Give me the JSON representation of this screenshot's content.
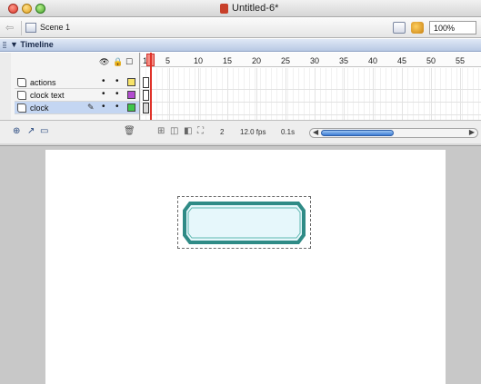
{
  "window": {
    "title": "Untitled-6*"
  },
  "edit_bar": {
    "scene_label": "Scene 1",
    "zoom_value": "100%"
  },
  "timeline": {
    "title": "Timeline",
    "frame_numbers": [
      "1",
      "5",
      "10",
      "15",
      "20",
      "25",
      "30",
      "35",
      "40",
      "45",
      "50",
      "55"
    ],
    "layers": [
      {
        "name": "actions",
        "color": "#f7e36a",
        "selected": false
      },
      {
        "name": "clock text",
        "color": "#b24ccf",
        "selected": false
      },
      {
        "name": "clock",
        "color": "#3fc64a",
        "selected": true
      }
    ],
    "status": {
      "current_frame": "2",
      "frame_rate": "12.0 fps",
      "elapsed_time": "0.1s"
    }
  },
  "colors": {
    "clock_fill": "#e6f7fb",
    "clock_stroke": "#2f8b86",
    "playhead": "#e0332a"
  }
}
